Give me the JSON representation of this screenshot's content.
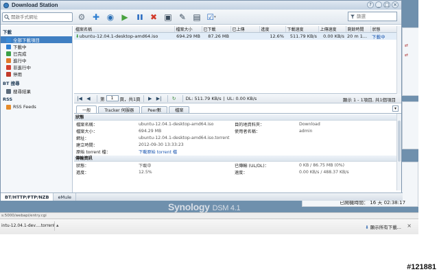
{
  "window": {
    "title": "Download Station",
    "controls": [
      "?",
      "_",
      "□",
      "×"
    ]
  },
  "toolbar": {
    "search_placeholder": "開啟手式網址",
    "filter_placeholder": "篩選",
    "buttons": [
      {
        "name": "settings-button",
        "icon": "gear-icon",
        "glyph": "⚙",
        "color": "#6b7a89"
      },
      {
        "name": "add-button",
        "icon": "plus-icon",
        "glyph": "✚",
        "color": "#2f7fd1"
      },
      {
        "name": "search-torrent-button",
        "icon": "globe-search-icon",
        "glyph": "◉",
        "color": "#2a6fb5"
      },
      {
        "name": "resume-button",
        "icon": "play-icon",
        "glyph": "▶",
        "color": "#48a23f"
      },
      {
        "name": "pause-button",
        "icon": "pause-icon",
        "glyph": "❚❚",
        "color": "#2f6fc2"
      },
      {
        "name": "delete-button",
        "icon": "delete-x-icon",
        "glyph": "✖",
        "color": "#d23a2a"
      },
      {
        "name": "save-button",
        "icon": "floppy-icon",
        "glyph": "▣",
        "color": "#3a4b5c"
      },
      {
        "name": "edit-button",
        "icon": "edit-icon",
        "glyph": "✎",
        "color": "#3a4b5c"
      },
      {
        "name": "calc-button",
        "icon": "calculator-icon",
        "glyph": "▤",
        "color": "#3a4b5c"
      },
      {
        "name": "select-button",
        "icon": "checkbox-dropdown-icon",
        "glyph": "☑",
        "color": "#2f6fc2"
      }
    ]
  },
  "sidebar": {
    "sections": [
      {
        "title": "下載",
        "items": [
          {
            "label": "全部下載項目",
            "selected": true,
            "color": "#3a8ad6"
          },
          {
            "label": "下載中",
            "selected": false,
            "color": "#2f7fd1"
          },
          {
            "label": "已完成",
            "selected": false,
            "color": "#3aa047"
          },
          {
            "label": "進行中",
            "selected": false,
            "color": "#e07a2b"
          },
          {
            "label": "非進行中",
            "selected": false,
            "color": "#d2402f"
          },
          {
            "label": "停用",
            "selected": false,
            "color": "#c23a2a"
          }
        ]
      },
      {
        "title": "BT 搜尋",
        "items": [
          {
            "label": "搜尋結果",
            "selected": false,
            "color": "#5a6a7a"
          }
        ]
      },
      {
        "title": "RSS",
        "items": [
          {
            "label": "RSS Feeds",
            "selected": false,
            "color": "#e58b2a"
          }
        ]
      }
    ]
  },
  "grid": {
    "columns": [
      "檔案名稱",
      "檔案大小",
      "已下載",
      "已上傳",
      "進度",
      "下載速度",
      "上傳速度",
      "剩餘時間",
      "狀態"
    ],
    "rows": [
      {
        "name": "ubuntu-12.04.1-desktop-amd64.iso",
        "size": "694.29 MB",
        "downloaded": "87.26 MB",
        "uploaded": "",
        "progress": "12.6%",
        "down_speed": "511.79 KB/s",
        "up_speed": "0.00 KB/s",
        "remaining": "20 m 1...",
        "status": "下載中"
      }
    ]
  },
  "pager": {
    "page_prefix": "第",
    "page_value": "1",
    "page_suffix": "頁，共1頁",
    "dl_speed": "DL: 511.79 KB/s",
    "ul_speed": "UL: 0.00 KB/s",
    "summary": "顯示 1 - 1項目, 共1個項目"
  },
  "detail_tabs": [
    "一般",
    "Tracker 伺服器",
    "Peer數",
    "檔案"
  ],
  "general": {
    "section_title": "狀態",
    "rows": [
      {
        "l1": "檔案名稱：",
        "v1": "ubuntu-12.04.1-desktop-amd64.iso",
        "l2": "目的地資料夾：",
        "v2": "Download"
      },
      {
        "l1": "檔案大小：",
        "v1": "694.29 MB",
        "l2": "使用者名稱：",
        "v2": "admin"
      },
      {
        "l1": "網址：",
        "v1": "ubuntu-12.04.1-desktop-amd64.iso.torrent",
        "l2": "",
        "v2": ""
      },
      {
        "l1": "建立時間：",
        "v1": "2012-09-30 13:33:23",
        "l2": "",
        "v2": ""
      },
      {
        "l1": "原始 torrent 檔：",
        "v1": "下載原始 torrent 檔",
        "l2": "",
        "v2": ""
      }
    ]
  },
  "transfer": {
    "section_title": "傳輸資訊",
    "rows": [
      {
        "l1": "狀態：",
        "v1": "下載中",
        "l2": "已傳輸 (UL/DL)：",
        "v2": "0 KB / 86.75 MB (0%)"
      },
      {
        "l1": "進度：",
        "v1": "12.5%",
        "l2": "速度：",
        "v2": "0.00 KB/s / 488.37 KB/s"
      }
    ]
  },
  "bottom_tabs": [
    "BT/HTTP/FTP/NZB",
    "eMule"
  ],
  "desktop": {
    "logo": "Synology",
    "logo_version": "DSM 4.1",
    "clock_label": "已開機時間：",
    "clock_value": "16 天 02:38:17"
  },
  "statusbar": {
    "text": "s:5000/webapi/entry.cgi"
  },
  "download_bar": {
    "item": "intu-12.04.1-dev….torrent",
    "show_all": "顯示所有下載..."
  },
  "watermark": "#121881"
}
